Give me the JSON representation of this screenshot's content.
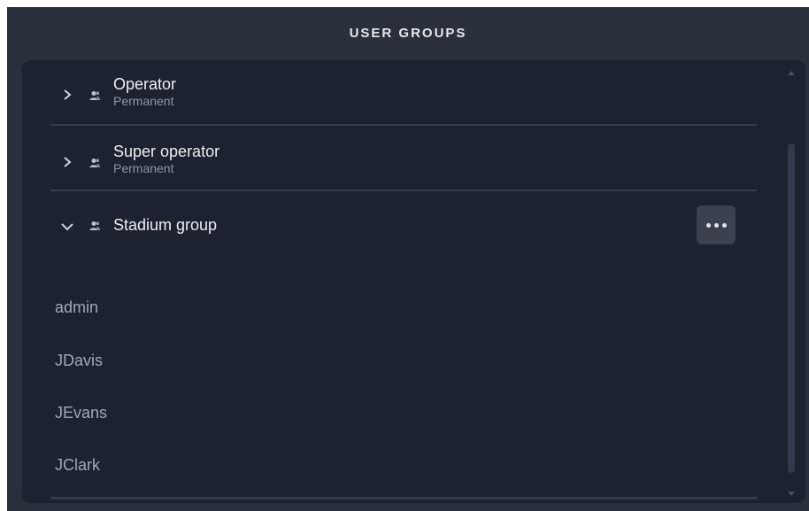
{
  "header": {
    "title": "USER GROUPS"
  },
  "groups": [
    {
      "name": "Operator",
      "subtitle": "Permanent",
      "expanded": false,
      "icon": "group-icon",
      "chevron": "chevron-right-icon"
    },
    {
      "name": "Super operator",
      "subtitle": "Permanent",
      "expanded": false,
      "icon": "group-icon",
      "chevron": "chevron-right-icon"
    },
    {
      "name": "Stadium group",
      "subtitle": "",
      "expanded": true,
      "icon": "group-icon",
      "chevron": "chevron-down-icon",
      "action_icon": "more-horizontal-icon"
    }
  ],
  "members": [
    "admin",
    "JDavis",
    "JEvans",
    "JClark"
  ],
  "colors": {
    "background": "#2a2f3c",
    "panel": "#1d2230",
    "divider": "#373d4b",
    "title": "#e6e8ee",
    "text_primary": "#eceef2",
    "text_secondary": "#8e94a0",
    "member_text": "#a2a7b2",
    "button_bg": "#3b414f"
  }
}
